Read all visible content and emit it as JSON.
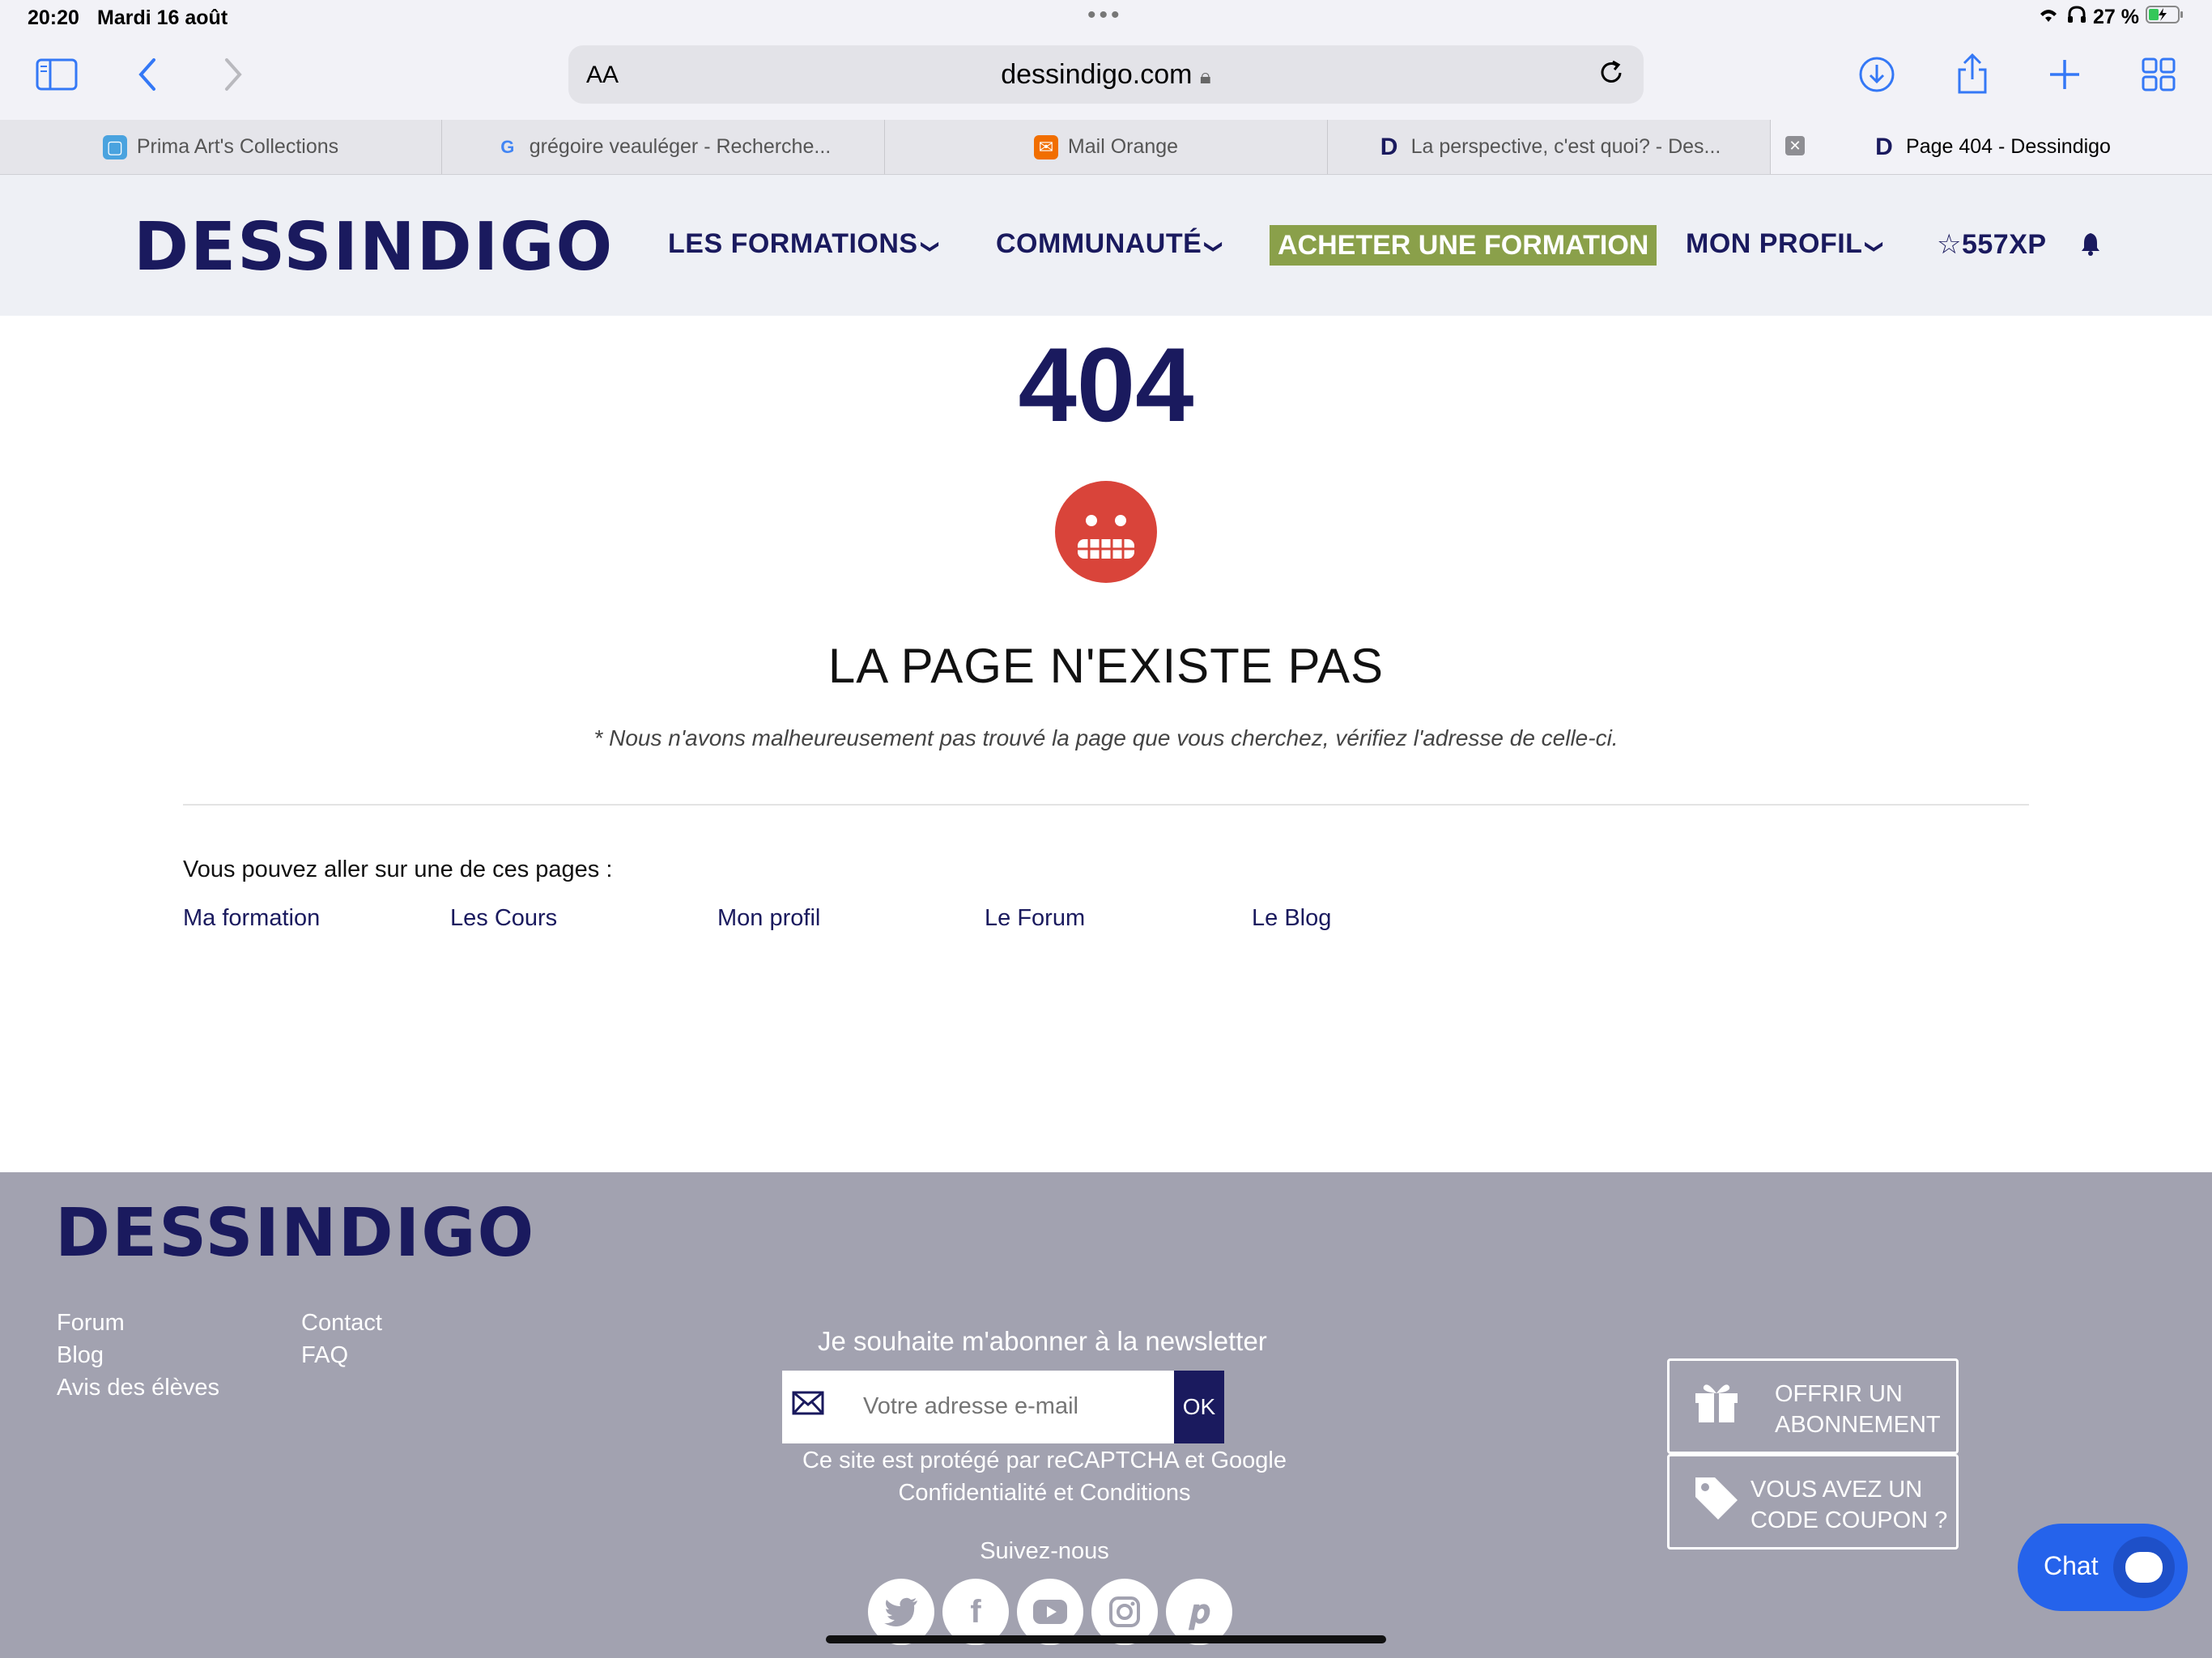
{
  "status_bar": {
    "time": "20:20",
    "date": "Mardi 16 août",
    "battery": "27 %"
  },
  "browser": {
    "aa_label": "AA",
    "url": "dessindigo.com",
    "tabs": [
      {
        "label": "Prima Art's Collections"
      },
      {
        "label": "grégoire veauléger - Recherche..."
      },
      {
        "label": "Mail Orange"
      },
      {
        "label": "La perspective, c'est quoi? - Des..."
      },
      {
        "label": "Page 404 - Dessindigo"
      }
    ]
  },
  "header": {
    "logo": "DESSINDIGO",
    "nav": {
      "formations": "LES FORMATIONS",
      "communaute": "COMMUNAUTÉ",
      "acheter": "ACHETER UNE FORMATION",
      "profil": "MON PROFIL",
      "xp": "557XP"
    }
  },
  "main": {
    "code": "404",
    "title": "LA PAGE N'EXISTE PAS",
    "subtitle": "* Nous n'avons malheureusement pas trouvé la page que vous cherchez, vérifiez l'adresse de celle-ci.",
    "pages_label": "Vous pouvez aller sur une de ces pages :",
    "links": [
      "Ma formation",
      "Les Cours",
      "Mon profil",
      "Le Forum",
      "Le Blog"
    ]
  },
  "footer": {
    "logo": "DESSINDIGO",
    "col1": [
      "Forum",
      "Blog",
      "Avis des élèves"
    ],
    "col2": [
      "Contact",
      "FAQ"
    ],
    "newsletter_title": "Je souhaite m'abonner à la newsletter",
    "email_placeholder": "Votre adresse e-mail",
    "ok_label": "OK",
    "captcha_line1": "Ce site est protégé par reCAPTCHA et Google",
    "captcha_line2": "Confidentialité et Conditions",
    "follow_label": "Suivez-nous",
    "offer_line1": "OFFRIR UN",
    "offer_line2": "ABONNEMENT",
    "coupon_line1": "VOUS AVEZ UN",
    "coupon_line2": "CODE COUPON ?"
  },
  "chat_label": "Chat",
  "colors": {
    "brand": "#1a1a5e",
    "accent_green": "#8aa04a",
    "footer_bg": "#a2a2b0",
    "error_red": "#d9443a",
    "chat_blue": "#2563eb"
  }
}
